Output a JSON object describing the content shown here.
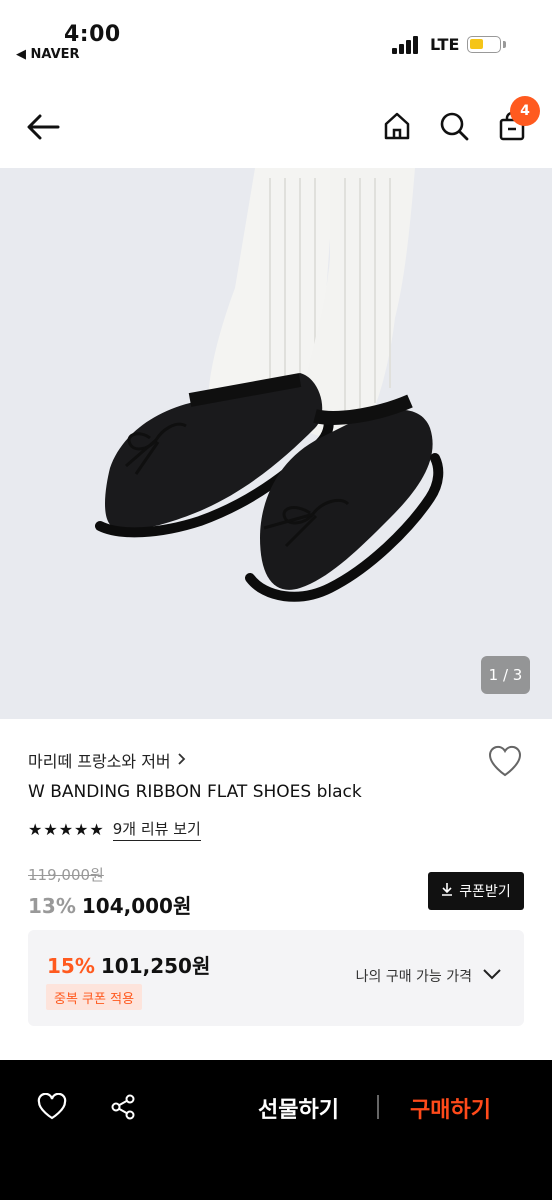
{
  "status_bar": {
    "time": "4:00",
    "back_app": "◀ NAVER",
    "network": "LTE",
    "battery_color": "#f5c518"
  },
  "header": {
    "back_icon": "arrow-left-icon",
    "home_icon": "home-icon",
    "search_icon": "search-icon",
    "cart_icon": "shopping-bag-icon",
    "cart_count": "4"
  },
  "hero": {
    "image_counter": "1 / 3"
  },
  "product": {
    "brand": "마리떼 프랑소와 저버",
    "title": "W BANDING RIBBON FLAT SHOES black",
    "stars": "★★★★★",
    "review_link": "9개 리뷰 보기",
    "original_price": "119,000원",
    "discount_rate": "13%",
    "price": "104,000원",
    "coupon_button": "쿠폰받기"
  },
  "best_price": {
    "discount_rate": "15%",
    "price": "101,250원",
    "tag": "중복 쿠폰 적용",
    "my_price_label": "나의 구매 가능 가격"
  },
  "bottom_bar": {
    "gift_label": "선물하기",
    "buy_label": "구매하기",
    "accent": "#ff4a1a"
  }
}
